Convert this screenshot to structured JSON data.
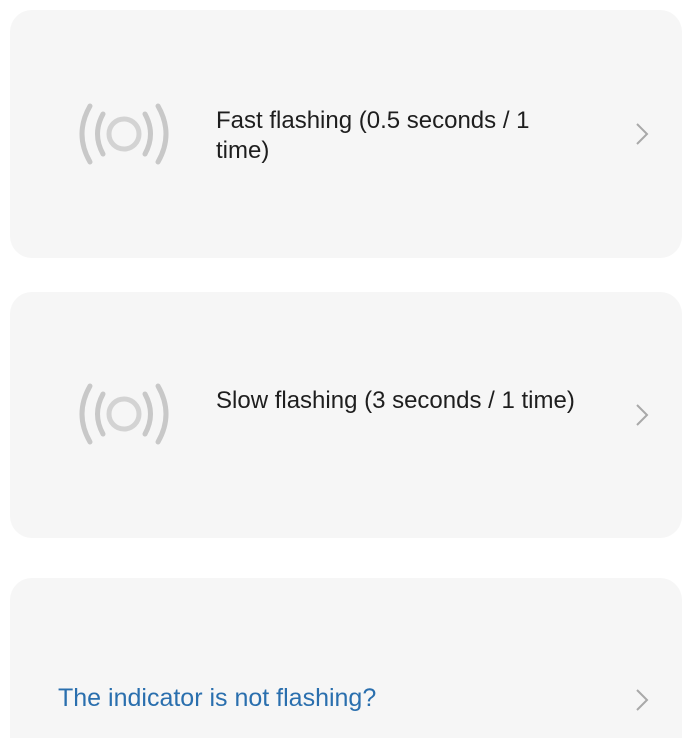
{
  "options": [
    {
      "id": "fast",
      "label": "Fast flashing (0.5 seconds / 1 time)",
      "icon": "signal-waves-icon",
      "chevron": "chevron-right-icon"
    },
    {
      "id": "slow",
      "label": "Slow flashing (3 seconds / 1 time)",
      "icon": "signal-waves-icon",
      "chevron": "chevron-right-icon"
    }
  ],
  "help": {
    "label": "The indicator is not flashing?",
    "chevron": "chevron-right-icon"
  },
  "colors": {
    "card_background": "#f6f6f6",
    "icon_gray": "#c8c8c8",
    "text_primary": "#1e1e1e",
    "link_blue": "#2a6fae",
    "chevron_gray": "#a9a9a9"
  }
}
